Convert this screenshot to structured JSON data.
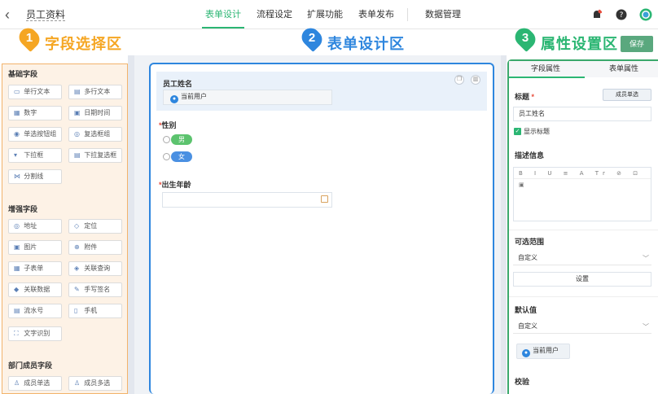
{
  "topbar": {
    "back_icon": "chevron-left-icon",
    "app_title": "员工资料",
    "tabs": [
      {
        "label": "表单设计",
        "active": true
      },
      {
        "label": "流程设定",
        "active": false
      },
      {
        "label": "扩展功能",
        "active": false
      },
      {
        "label": "表单发布",
        "active": false
      },
      {
        "label": "数据管理",
        "active": false
      }
    ],
    "icons": [
      "notification-icon",
      "help-icon",
      "user-avatar-icon"
    ]
  },
  "banner": {
    "zones": [
      {
        "num": "1",
        "title": "字段选择区",
        "color": "#f5a623"
      },
      {
        "num": "2",
        "title": "表单设计区",
        "color": "#2e86de"
      },
      {
        "num": "3",
        "title": "属性设置区",
        "color": "#2bb673"
      }
    ],
    "save_label": "保存"
  },
  "left": {
    "groups": [
      {
        "title": "基础字段",
        "items": [
          "单行文本",
          "多行文本",
          "数字",
          "日期时间",
          "单选按钮组",
          "复选框组",
          "下拉框",
          "下拉复选框",
          "分割线"
        ]
      },
      {
        "title": "增强字段",
        "items": [
          "地址",
          "定位",
          "图片",
          "附件",
          "子表单",
          "关联查询",
          "关联数据",
          "手写签名",
          "流水号",
          "手机",
          "文字识别"
        ]
      },
      {
        "title": "部门成员字段",
        "items": [
          "成员单选",
          "成员多选"
        ]
      }
    ],
    "icons": [
      "▭",
      "▤",
      "▦",
      "▣",
      "◉",
      "◎",
      "▾",
      "▤",
      "⋈",
      "◎",
      "◇",
      "▣",
      "⊕",
      "▦",
      "◈",
      "◆",
      "✎",
      "▤",
      "▯",
      "⛶",
      "♙",
      "♙"
    ]
  },
  "form": {
    "fields": [
      {
        "label": "员工姓名",
        "value": "当前用户",
        "required": false
      },
      {
        "label": "性别",
        "required": true,
        "options": [
          "男",
          "女"
        ]
      },
      {
        "label": "出生年龄",
        "required": true
      }
    ],
    "option_colors": [
      "#5cc36e",
      "#4a90e2"
    ]
  },
  "right": {
    "tabs": [
      "字段属性",
      "表单属性"
    ],
    "title_label": "标题",
    "title_btn": "成员单选",
    "title_value": "员工姓名",
    "show_title": "显示标题",
    "desc_label": "描述信息",
    "editor_tools": "B I U ≡ A Tr ⊘ ⊡ ▣",
    "range_label": "可选范围",
    "range_value": "自定义",
    "settings_btn": "设置",
    "default_label": "默认值",
    "default_value": "自定义",
    "default_user": "当前用户",
    "validate_label": "校验"
  }
}
